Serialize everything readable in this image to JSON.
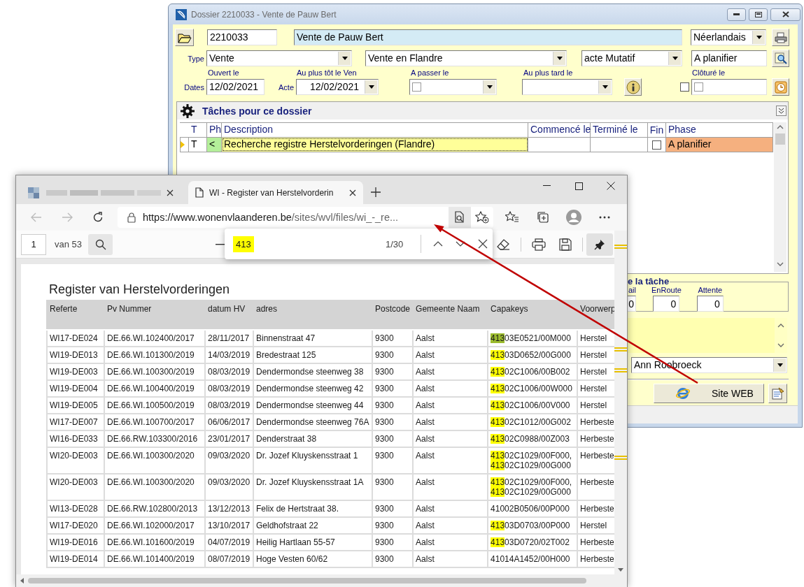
{
  "dialog": {
    "title": "Dossier 2210033 - Vente de Pauw Bert",
    "number": "2210033",
    "name": "Vente de Pauw Bert",
    "language": "Néerlandais",
    "type_label": "Type",
    "type": "Vente",
    "subtype": "Vente en Flandre",
    "act": "acte Mutatif",
    "status": "A planifier",
    "dates": {
      "label": "Dates",
      "opened_label": "Ouvert le",
      "opened": "12/02/2021",
      "acte_label": "Acte",
      "earliest_label": "Au plus tôt le Ven",
      "earliest": "12/02/2021",
      "pass_label": "A passer le",
      "pass_checked": false,
      "latest_label": "Au plus tard le",
      "closed_label": "Clôturé le",
      "closed_checked": false,
      "closed_date_checked": false
    },
    "tasks": {
      "title": "Tâches pour ce dossier",
      "columns": [
        "T",
        "Ph",
        "Description",
        "Commencé le",
        "Terminé le",
        "Fin",
        "Phase"
      ],
      "rows": [
        {
          "type": "T",
          "ph": "<",
          "description": "Recherche registre Herstelvorderingen (Flandre)",
          "done": false,
          "phase": "A planifier",
          "selected": true
        }
      ]
    },
    "task_detail": {
      "legend": "e la tâche",
      "counters": [
        {
          "label": "ail",
          "value": "0"
        },
        {
          "label": "EnRoute",
          "value": "0"
        },
        {
          "label": "Attente",
          "value": "0"
        }
      ]
    },
    "assignee": "Ann Roobroeck",
    "web_button": "Site WEB"
  },
  "browser": {
    "tabs": [
      {
        "kind": "blurred",
        "selected": false
      },
      {
        "kind": "page",
        "title": "WI - Register van Herstelvorderin",
        "selected": true
      }
    ],
    "url": {
      "host": "https://www.wonenvlaanderen.be",
      "path": "/sites/wvl/files/wi_-_re..."
    },
    "pdf": {
      "page": "1",
      "page_count": "van 53"
    },
    "find": {
      "query": "413",
      "count": "1/30"
    },
    "document": {
      "title": "Register van Herstelvorderingen",
      "columns": [
        "Referte",
        "Pv Nummer",
        "datum HV",
        "adres",
        "Postcode",
        "Gemeente Naam",
        "Capakeys",
        "Voorwerp"
      ],
      "rows": [
        {
          "referte": "WI17-DE024",
          "pv": "DE.66.WI.102400/2017",
          "datum": "28/11/2017",
          "adres": "Binnenstraat 47",
          "postcode": "9300",
          "gemeente": "Aalst",
          "capakeys": [
            {
              "highlight": "413",
              "text": "03E0521/00M000",
              "current": true
            }
          ],
          "voorwerp": "Herstel"
        },
        {
          "referte": "WI19-DE013",
          "pv": "DE.66.WI.101300/2019",
          "datum": "14/03/2019",
          "adres": "Bredestraat 125",
          "postcode": "9300",
          "gemeente": "Aalst",
          "capakeys": [
            {
              "highlight": "413",
              "text": "03D0652/00G000",
              "current": false
            }
          ],
          "voorwerp": "Herstel"
        },
        {
          "referte": "WI19-DE003",
          "pv": "DE.66.WI.100300/2019",
          "datum": "08/03/2019",
          "adres": "Dendermondse steenweg 38",
          "postcode": "9300",
          "gemeente": "Aalst",
          "capakeys": [
            {
              "highlight": "413",
              "text": "02C1006/00B002",
              "current": false
            }
          ],
          "voorwerp": "Herstel"
        },
        {
          "referte": "WI19-DE004",
          "pv": "DE.66.WI.100400/2019",
          "datum": "08/03/2019",
          "adres": "Dendermondse steenweg 42",
          "postcode": "9300",
          "gemeente": "Aalst",
          "capakeys": [
            {
              "highlight": "413",
              "text": "02C1006/00W000",
              "current": false
            }
          ],
          "voorwerp": "Herstel"
        },
        {
          "referte": "WI19-DE005",
          "pv": "DE.66.WI.100500/2019",
          "datum": "08/03/2019",
          "adres": "Dendermondse steenweg 44",
          "postcode": "9300",
          "gemeente": "Aalst",
          "capakeys": [
            {
              "highlight": "413",
              "text": "02C1006/00V000",
              "current": false
            }
          ],
          "voorwerp": "Herstel"
        },
        {
          "referte": "WI17-DE007",
          "pv": "DE.66.WI.100700/2017",
          "datum": "06/06/2017",
          "adres": "Dendermondse steenweg 76A",
          "postcode": "9300",
          "gemeente": "Aalst",
          "capakeys": [
            {
              "highlight": "413",
              "text": "02C1012/00G002",
              "current": false
            }
          ],
          "voorwerp": "Herbeste"
        },
        {
          "referte": "WI16-DE033",
          "pv": "DE.66.RW.103300/2016",
          "datum": "23/01/2017",
          "adres": "Denderstraat 38",
          "postcode": "9300",
          "gemeente": "Aalst",
          "capakeys": [
            {
              "highlight": "413",
              "text": "02C0988/00Z003",
              "current": false
            }
          ],
          "voorwerp": "Herbeste"
        },
        {
          "referte": "WI20-DE003",
          "pv": "DE.66.WI.100300/2020",
          "datum": "09/03/2020",
          "adres": "Dr. Jozef Kluyskensstraat 1",
          "postcode": "9300",
          "gemeente": "Aalst",
          "capakeys": [
            {
              "highlight": "413",
              "text": "02C1029/00F000,",
              "current": false
            },
            {
              "highlight": "413",
              "text": "02C1029/00G000",
              "current": false
            }
          ],
          "voorwerp": "Herbeste"
        },
        {
          "referte": "WI20-DE003",
          "pv": "DE.66.WI.100300/2020",
          "datum": "09/03/2020",
          "adres": "Dr. Jozef Kluyskensstraat 1A",
          "postcode": "9300",
          "gemeente": "Aalst",
          "capakeys": [
            {
              "highlight": "413",
              "text": "02C1029/00F000,",
              "current": false
            },
            {
              "highlight": "413",
              "text": "02C1029/00G000",
              "current": false
            }
          ],
          "voorwerp": "Herbeste"
        },
        {
          "referte": "WI13-DE028",
          "pv": "DE.66.RW.102800/2013",
          "datum": "13/12/2013",
          "adres": "Felix de Hertstraat 38.",
          "postcode": "9300",
          "gemeente": "Aalst",
          "capakeys": [
            {
              "text": "41002B0506/00P000"
            }
          ],
          "voorwerp": "Herbeste"
        },
        {
          "referte": "WI17-DE020",
          "pv": "DE.66.WI.102000/2017",
          "datum": "13/10/2017",
          "adres": "Geldhofstraat 22",
          "postcode": "9300",
          "gemeente": "Aalst",
          "capakeys": [
            {
              "highlight": "413",
              "text": "03D0703/00P000",
              "current": false
            }
          ],
          "voorwerp": "Herstel"
        },
        {
          "referte": "WI19-DE016",
          "pv": "DE.66.WI.101600/2019",
          "datum": "04/07/2019",
          "adres": "Heilig Hartlaan 55-57",
          "postcode": "9300",
          "gemeente": "Aalst",
          "capakeys": [
            {
              "highlight": "413",
              "text": "03D0720/02T002",
              "current": false
            }
          ],
          "voorwerp": "Herbeste"
        },
        {
          "referte": "WI19-DE014",
          "pv": "DE.66.WI.101400/2019",
          "datum": "08/07/2019",
          "adres": "Hoge Vesten 60/62",
          "postcode": "9300",
          "gemeente": "Aalst",
          "capakeys": [
            {
              "text": "41014A1452/00H000"
            }
          ],
          "voorwerp": "Herbeste"
        }
      ]
    }
  }
}
